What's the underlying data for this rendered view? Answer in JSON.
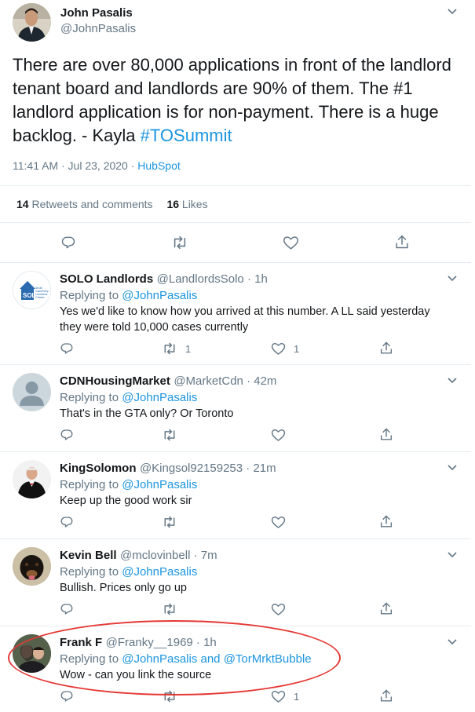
{
  "tweet": {
    "author_name": "John Pasalis",
    "author_handle": "@JohnPasalis",
    "text_before": "There are over 80,000 applications in front of the landlord tenant board and landlords are 90% of them. The #1 landlord application is for non-payment. There is a huge backlog.  - Kayla ",
    "hashtag": "#TOSummit",
    "timestamp": "11:41 AM · Jul 23, 2020 · ",
    "source": "HubSpot",
    "retweets_count": "14",
    "retweets_label": "Retweets and comments",
    "likes_count": "16",
    "likes_label": "Likes"
  },
  "replies": [
    {
      "name": "SOLO Landlords",
      "handle": "@LandlordsSolo · 1h",
      "replying_prefix": "Replying to ",
      "replying_to": "@JohnPasalis",
      "text": "Yes we'd like to know how you arrived at this number. A LL said yesterday they were told 10,000 cases currently",
      "retweets": "1",
      "likes": "1"
    },
    {
      "name": "CDNHousingMarket",
      "handle": "@MarketCdn · 42m",
      "replying_prefix": "Replying to ",
      "replying_to": "@JohnPasalis",
      "text": "That's in the GTA only? Or Toronto",
      "retweets": "",
      "likes": ""
    },
    {
      "name": "KingSolomon",
      "handle": "@Kingsol92159253 · 21m",
      "replying_prefix": "Replying to ",
      "replying_to": "@JohnPasalis",
      "text": "Keep up the good work sir",
      "retweets": "",
      "likes": ""
    },
    {
      "name": "Kevin Bell",
      "handle": "@mclovinbell · 7m",
      "replying_prefix": "Replying to ",
      "replying_to": "@JohnPasalis",
      "text": "Bullish.  Prices only go up",
      "retweets": "",
      "likes": ""
    },
    {
      "name": "Frank F",
      "handle": "@Franky__1969 · 1h",
      "replying_prefix": "Replying to ",
      "replying_to": "@JohnPasalis and @TorMrktBubble",
      "text": "Wow - can you link the source",
      "retweets": "",
      "likes": "1"
    }
  ],
  "logo_text": [
    "SOLO",
    "Small",
    "Ownership",
    "Landlords",
    "Ontario"
  ],
  "colors": {
    "link": "#1b95e0",
    "muted": "#657786",
    "text": "#14171a",
    "divider": "#e6ecf0",
    "highlight": "#e53935"
  }
}
